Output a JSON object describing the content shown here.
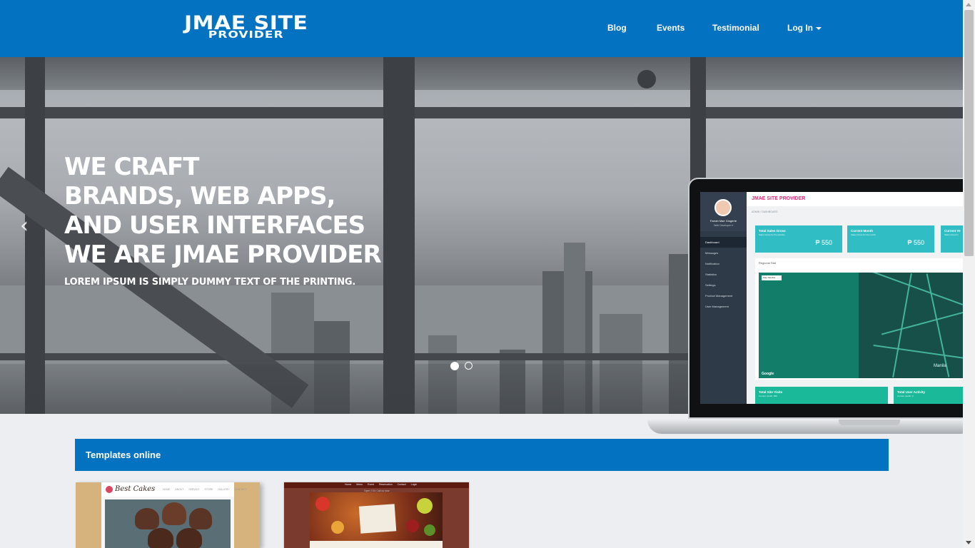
{
  "navbar": {
    "brand_line1": "JMAE SITE",
    "brand_line2": "PROVIDER",
    "links": {
      "blog": "Blog",
      "events": "Events",
      "testimonial": "Testimonial",
      "login": "Log In"
    },
    "bg_color": "#0373c1"
  },
  "hero": {
    "line1": "WE CRAFT",
    "line2": "BRANDS, WEB APPS,",
    "line3": "AND USER INTERFACES",
    "line4": "WE ARE JMAE PROVIDER",
    "subtitle": "LOREM IPSUM IS SIMPLY DUMMY TEXT OF THE PRINTING.",
    "prev_icon": "chevron-left-icon",
    "next_icon": "chevron-right-icon",
    "prev_glyph": "‹",
    "next_glyph": "›",
    "slides_count": 2,
    "active_slide": 1
  },
  "laptop_screen": {
    "title": "JMAE SITE PROVIDER",
    "breadcrumb": "ADMIN / DASHBOARD",
    "profile_name": "Farrah Mae Gingerte",
    "profile_role": "Web Developer ▾",
    "menu": [
      "Dashboard",
      "Messages",
      "Notification",
      "Statistics",
      "Settings",
      "Product Management",
      "User Management"
    ],
    "cards": [
      {
        "title": "Total Sales Gross",
        "sub": "Sales Gross for the website",
        "value": "₱ 550"
      },
      {
        "title": "Current Month",
        "sub": "Sales Gross for the month",
        "value": "₱ 550"
      },
      {
        "title": "Current Ye",
        "sub": "Sales Gross fo",
        "value": ""
      }
    ],
    "panel_title": "Regional Stat",
    "map_buttons": "Map   Satellite",
    "map_google": "Google",
    "map_city": "Manila",
    "bottom_cards": [
      {
        "title": "Total Site Visits",
        "sub": "Current month: 900"
      },
      {
        "title": "Total User Activity",
        "sub": "Current month: 3"
      }
    ]
  },
  "section": {
    "title": "Templates online"
  },
  "templates": {
    "t1_logo": "Best Cakes",
    "t1_menu": "HOME  ABOUT  SERVICE  STORE  GALLERY  CONTACT",
    "t2_menu": "Home  Menu  Event  Reservation  Contact  Login",
    "t2_sub": "Open 7/24  Call us now"
  },
  "colors": {
    "primary": "#0373c1",
    "page_bg": "#eceef1",
    "dashboard_teal": "#30bec4",
    "dashboard_green": "#1ab99a",
    "dashboard_title": "#d62f7f"
  }
}
